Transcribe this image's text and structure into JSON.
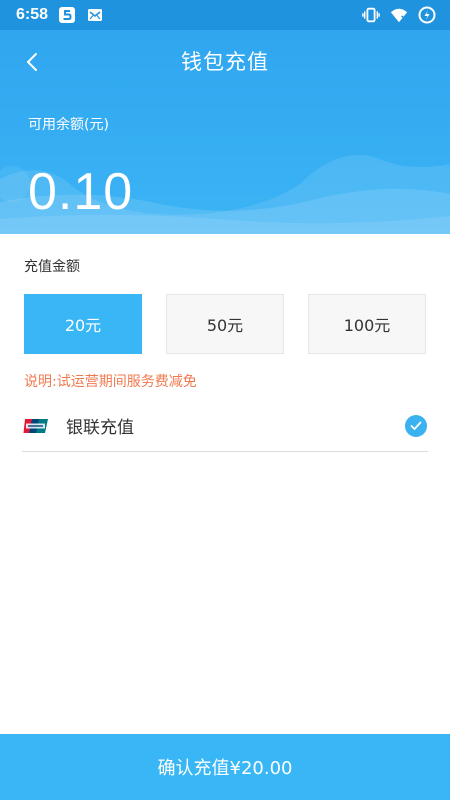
{
  "status_bar": {
    "time": "6:58",
    "left_icons": [
      "s-app-icon",
      "mail-icon"
    ],
    "right_icons": [
      "vibrate-icon",
      "wifi-icon",
      "battery-saver-icon"
    ]
  },
  "header": {
    "title": "钱包充值",
    "back_icon": "chevron-left-icon"
  },
  "balance": {
    "label": "可用余额(元)",
    "value": "0.10"
  },
  "amount_section": {
    "title": "充值金额",
    "options": [
      {
        "label": "20元",
        "selected": true
      },
      {
        "label": "50元",
        "selected": false
      },
      {
        "label": "100元",
        "selected": false
      }
    ],
    "note": "说明:试运营期间服务费减免"
  },
  "payment": {
    "method_label": "银联充值",
    "logo_icon": "unionpay-icon",
    "checked": true
  },
  "confirm_button": {
    "label": "确认充值¥20.00"
  },
  "colors": {
    "primary": "#38b6f5",
    "status_bar": "#1f93dd",
    "note": "#f07a4f"
  }
}
